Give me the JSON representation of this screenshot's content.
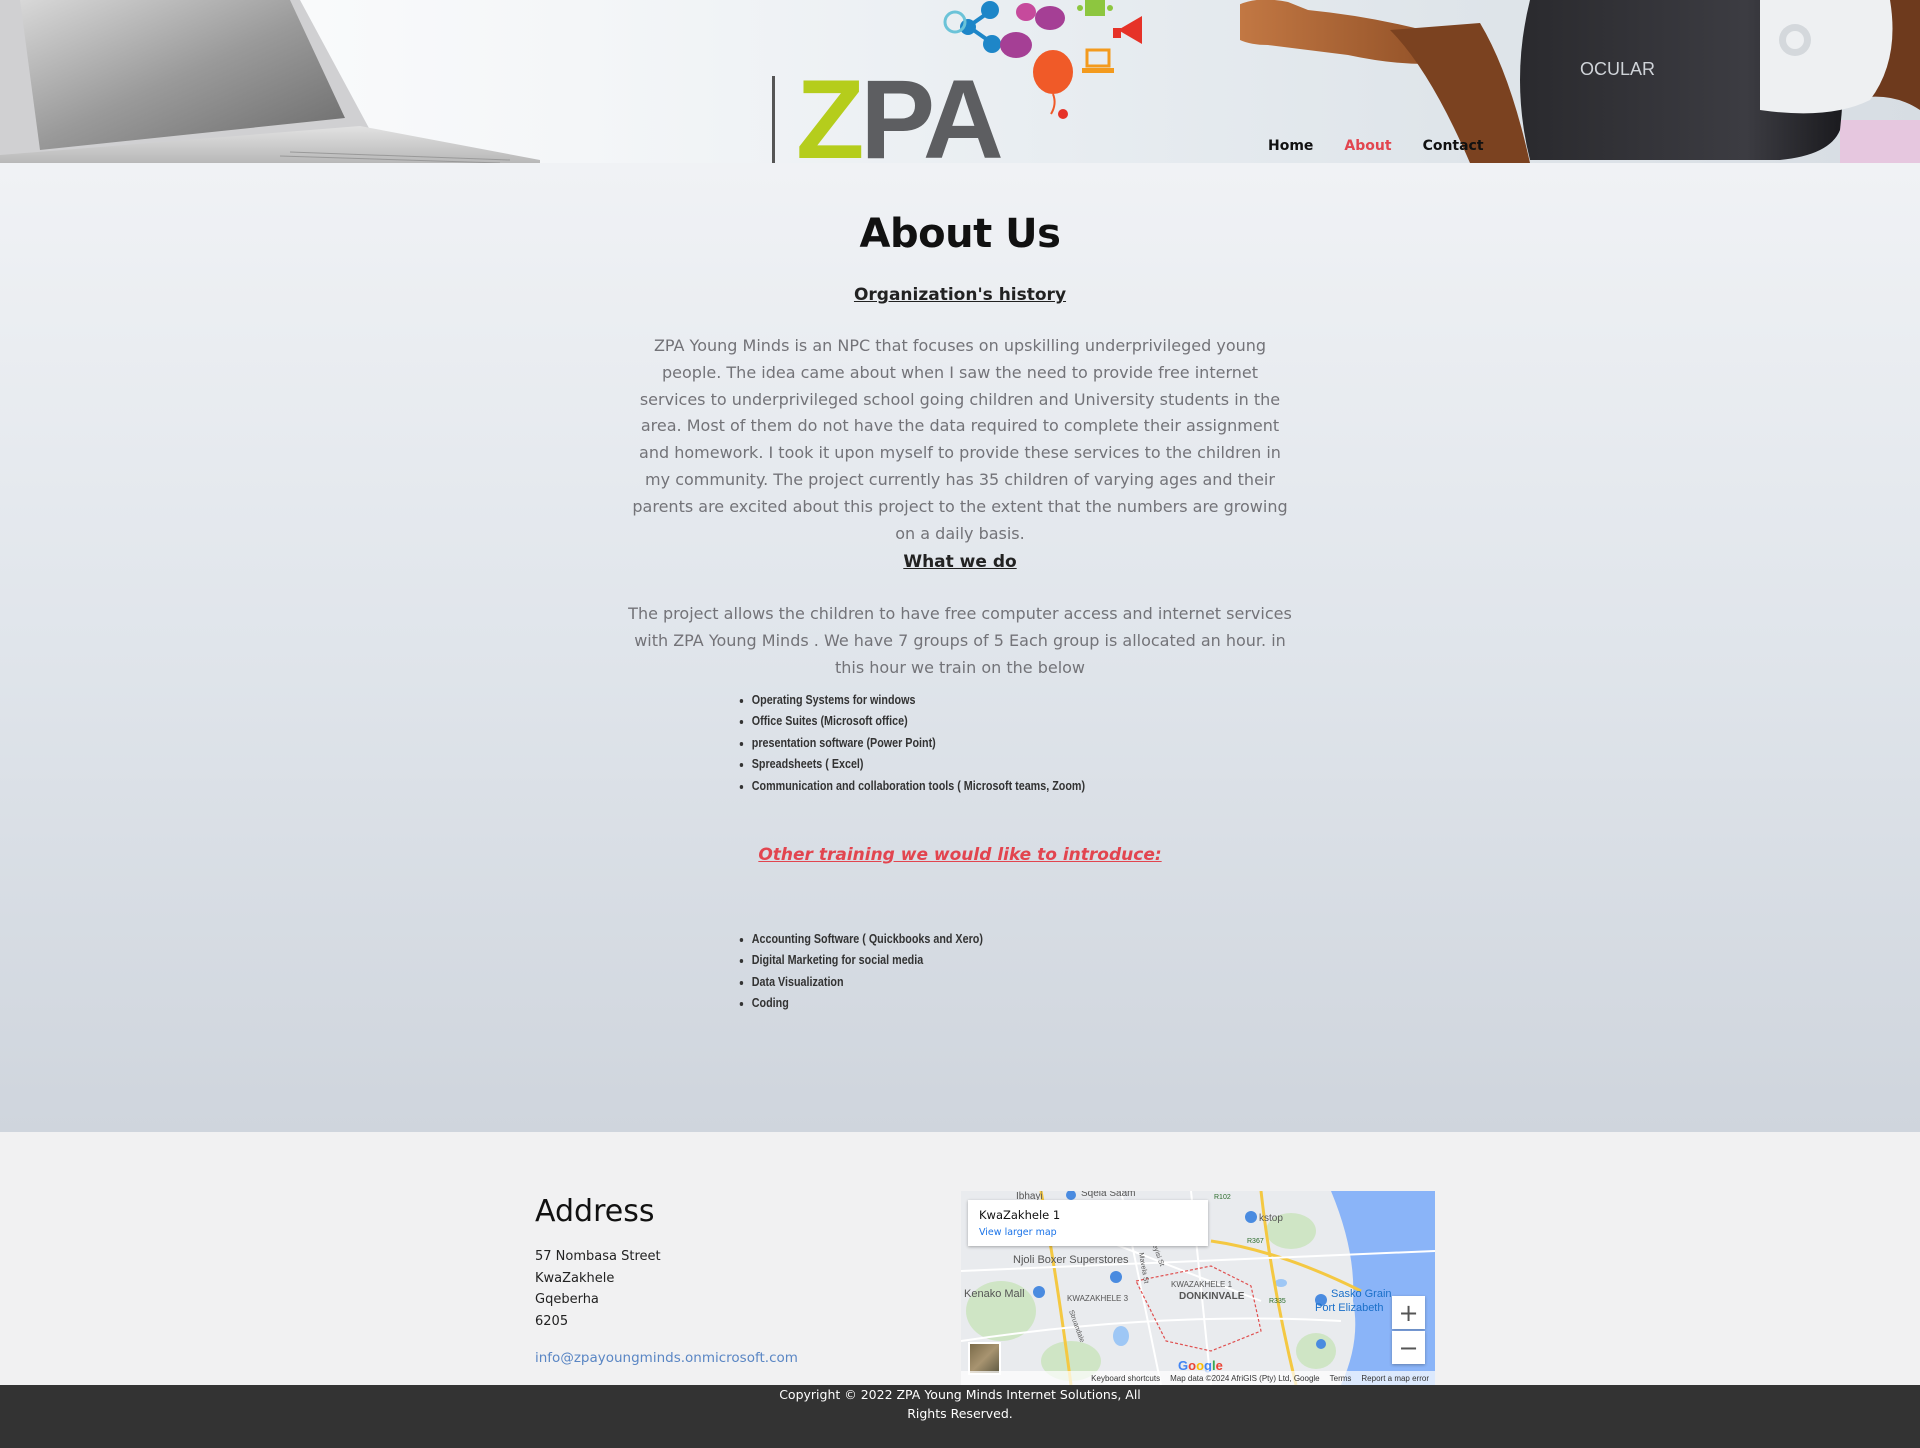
{
  "header": {
    "logo_text": "ZPA",
    "laptop_brand": "",
    "vr_brand": "OCULAR"
  },
  "nav": {
    "items": [
      {
        "label": "Home",
        "active": false
      },
      {
        "label": "About",
        "active": true
      },
      {
        "label": "Contact",
        "active": false
      }
    ],
    "active_color": "#e2454f"
  },
  "main": {
    "title": "About Us",
    "history_heading": "Organization's history ",
    "history_text": "ZPA Young Minds is an NPC that focuses on upskilling underprivileged young people. The idea came about when I saw the need to provide free internet services to underprivileged school going children and University students in the area. Most of them do not have the data required to complete their assignment and homework. I took it upon myself to provide these services to the children in my community. The project currently has 35 children of varying ages and their parents are excited about this project to the extent that the numbers are growing on a daily basis.",
    "what_heading": "What we do",
    "what_text": "The project allows the children to have free computer access and internet services with ZPA Young Minds . We have 7 groups of 5  Each group is allocated an hour. in this hour we train on the below",
    "training_list": [
      "Operating Systems for windows",
      "Office Suites (Microsoft office)",
      "presentation software (Power Point)",
      "Spreadsheets ( Excel)",
      "Communication and collaboration tools ( Microsoft teams, Zoom)"
    ],
    "other_heading": "Other training we would like to introduce:",
    "other_list": [
      "Accounting Software ( Quickbooks and Xero)",
      "Digital Marketing for social media",
      "Data Visualization",
      "Coding"
    ]
  },
  "footer": {
    "address_title": "Address",
    "address_lines": [
      "57 Nombasa Street",
      "KwaZakhele",
      "Gqeberha",
      "6205"
    ],
    "email": "info@zpayoungminds.onmicrosoft.com",
    "copyright_line1": "Copyright © 2022 ZPA Young Minds Internet Solutions, All",
    "copyright_line2": "Rights Reserved."
  },
  "map": {
    "place_name": "KwaZakhele 1",
    "view_larger": "View larger map",
    "labels": {
      "sqela": "Sqela Saam",
      "njoli": "Njoli Boxer Superstores",
      "kenako": "Kenako Mall",
      "kwazakhele1": "KWAZAKHELE 1",
      "kwazakhele3": "KWAZAKHELE 3",
      "donkinvale": "DONKINVALE",
      "sasko": "Sasko Grain",
      "pe": "Port Elizabeth",
      "kstop": "kstop",
      "ibhayi": "Ibhayi",
      "seyisi": "Seyisi St",
      "mavela": "Mavela St",
      "struandale": "Struandale",
      "r102": "R102",
      "r367": "R367",
      "r335": "R335"
    },
    "google": "Google",
    "footer_items": [
      "Keyboard shortcuts",
      "Map data ©2024 AfriGIS (Pty) Ltd, Google",
      "Terms",
      "Report a map error"
    ],
    "zoom_in": "+",
    "zoom_out": "−"
  }
}
